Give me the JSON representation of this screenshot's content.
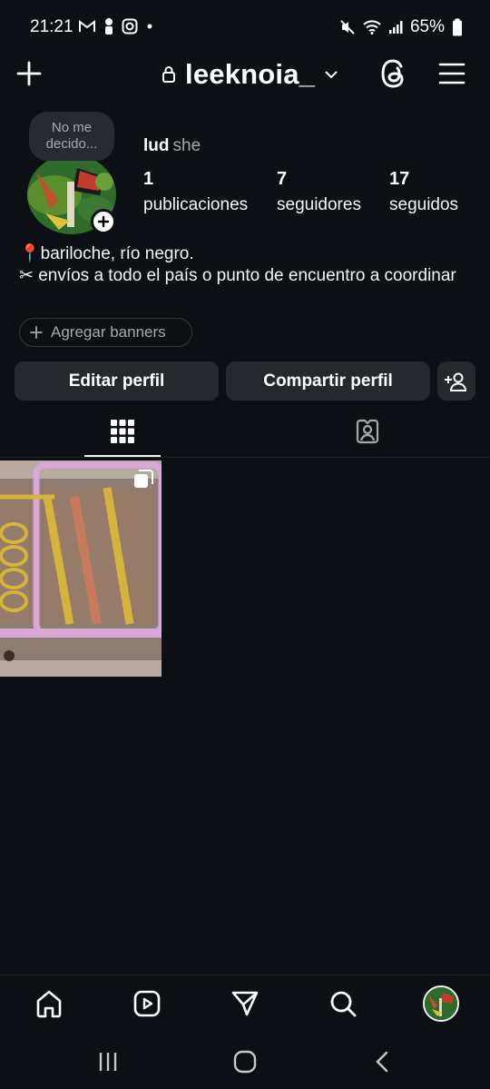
{
  "status_bar": {
    "time": "21:21",
    "battery": "65%",
    "left_icons": [
      "gmail-icon",
      "person-alert-icon",
      "instagram-icon",
      "dot-icon"
    ],
    "right_icons": [
      "mute-icon",
      "wifi-icon",
      "signal-icon",
      "battery-icon"
    ]
  },
  "header": {
    "username": "leeknoia_",
    "create_icon": "plus-icon",
    "threads_icon": "threads-icon",
    "menu_icon": "hamburger-icon"
  },
  "profile": {
    "note": "No me decido...",
    "name": "lud",
    "pronouns": "she",
    "stats": [
      {
        "value": "1",
        "label": "publicaciones"
      },
      {
        "value": "7",
        "label": "seguidores"
      },
      {
        "value": "17",
        "label": "seguidos"
      }
    ],
    "bio_line1": "📍bariloche, río negro.",
    "bio_line2": "✂ envíos a todo el país o punto de encuentro a coordinar",
    "banners_label": "Agregar banners"
  },
  "actions": {
    "edit_label": "Editar perfil",
    "share_label": "Compartir perfil"
  },
  "tabs": [
    {
      "name": "grid",
      "active": true
    },
    {
      "name": "tagged",
      "active": false
    }
  ],
  "colors": {
    "background": "#0c1014",
    "button": "#25292e",
    "muted_text": "#a8a8a8"
  }
}
